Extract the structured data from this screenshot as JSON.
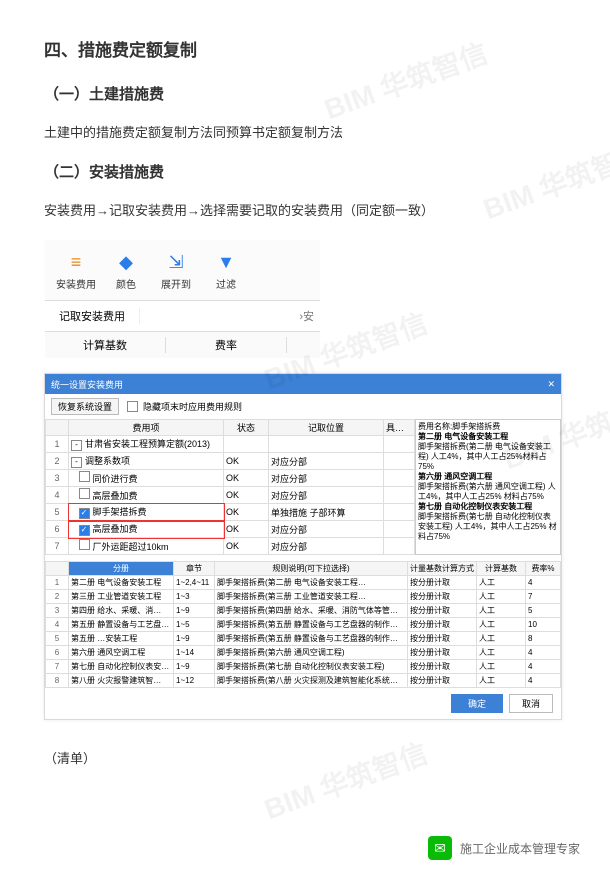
{
  "doc": {
    "h1": "四、措施费定额复制",
    "h2a": "（一）土建措施费",
    "p1": "土建中的措施费定额复制方法同预算书定额复制方法",
    "h2b": "（二）安装措施费",
    "p2": "安装费用→记取安装费用→选择需要记取的安装费用（同定额一致）",
    "note": "（清单）"
  },
  "toolbar": {
    "items": [
      {
        "icon": "≡",
        "label": "安装费用",
        "cls": "tb-orange"
      },
      {
        "icon": "◆",
        "label": "颜色",
        "cls": "tb-blue"
      },
      {
        "icon": "⇲",
        "label": "展开到",
        "cls": "tb-blue"
      },
      {
        "icon": "▼",
        "label": "过滤",
        "cls": "tb-blue"
      }
    ],
    "menu": "记取安装费用",
    "after_menu": "›安",
    "tab_a": "计算基数",
    "tab_b": "费率"
  },
  "dlg": {
    "title": "统一设置安装费用",
    "restore": "恢复系统设置",
    "chk_show": "隐藏项末时应用费用规则",
    "top_headers": [
      "",
      "费用项",
      "状态",
      "记取位置",
      "具体说明"
    ],
    "tree": [
      {
        "n": "1",
        "txt": "甘肃省安装工程预算定额(2013)",
        "open": "-",
        "st": "",
        "pos": "",
        "chk": null
      },
      {
        "n": "2",
        "txt": "调整系数项",
        "open": "-",
        "st": "OK",
        "pos": "对应分部",
        "chk": null
      },
      {
        "n": "3",
        "txt": "同价进行费",
        "st": "OK",
        "pos": "对应分部",
        "chk": false
      },
      {
        "n": "4",
        "txt": "高层叠加费",
        "st": "OK",
        "pos": "对应分部",
        "chk": false
      },
      {
        "n": "5",
        "txt": "脚手架搭拆费",
        "st": "OK",
        "pos": "单独措施  子部环算",
        "chk": true,
        "hl": true
      },
      {
        "n": "6",
        "txt": "高层叠加费",
        "st": "OK",
        "pos": "对应分部",
        "chk": true,
        "hl": true
      },
      {
        "n": "7",
        "txt": "厂外运距超过10km",
        "st": "OK",
        "pos": "对应分部",
        "chk": false
      }
    ],
    "side": {
      "t": "费用名称:脚手架搭拆费",
      "b1": "第二册 电气设备安装工程",
      "b1t": "脚手架搭拆费(第二册 电气设备安装工程) 人工4%，其中人工占25%材料占75%",
      "b2": "第六册 通风空调工程",
      "b2t": "脚手架搭拆费(第六册 通风空调工程) 人工4%，其中人工占25% 材料占75%",
      "b3": "第七册 自动化控制仪表安装工程",
      "b3t": "脚手架搭拆费(第七册 自动化控制仪表安装工程) 人工4%，其中人工占25% 材料占75%"
    },
    "bot_headers": [
      "",
      "分册",
      "章节",
      "规则说明(可下拉选择)",
      "计量基数计算方式",
      "计算基数",
      "费率%"
    ],
    "rows": [
      {
        "n": "1",
        "a": "第二册 电气设备安装工程",
        "b": "1~2,4~11",
        "c": "脚手架搭拆费(第二册 电气设备安装工程…",
        "d": "按分册计取",
        "e": "人工",
        "f": "4"
      },
      {
        "n": "2",
        "a": "第三册 工业管道安装工程",
        "b": "1~3",
        "c": "脚手架搭拆费(第三册 工业管道安装工程…",
        "d": "按分册计取",
        "e": "人工",
        "f": "7"
      },
      {
        "n": "3",
        "a": "第四册 给水、采暖、消…",
        "b": "1~9",
        "c": "脚手架搭拆费(第四册 给水、采暖、消防气体等管道安装工…",
        "d": "按分册计取",
        "e": "人工",
        "f": "5"
      },
      {
        "n": "4",
        "a": "第五册 静置设备与工艺盘…",
        "b": "1~5",
        "c": "脚手架搭拆费(第五册 静置设备与工艺盘器的制作安装工程…",
        "d": "按分册计取",
        "e": "人工",
        "f": "10"
      },
      {
        "n": "5",
        "a": "第五册 …安装工程",
        "b": "1~9",
        "c": "脚手架搭拆费(第五册 静置设备与工艺盘器的制作…",
        "d": "按分册计取",
        "e": "人工",
        "f": "8"
      },
      {
        "n": "6",
        "a": "第六册 通风空调工程",
        "b": "1~14",
        "c": "脚手架搭拆费(第六册 通风空调工程)",
        "d": "按分册计取",
        "e": "人工",
        "f": "4"
      },
      {
        "n": "7",
        "a": "第七册 自动化控制仪表安装…",
        "b": "1~9",
        "c": "脚手架搭拆费(第七册 自动化控制仪表安装工程)",
        "d": "按分册计取",
        "e": "人工",
        "f": "4"
      },
      {
        "n": "8",
        "a": "第八册 火灾报警建筑智…",
        "b": "1~12",
        "c": "脚手架搭拆费(第八册 火灾探测及建筑智能化系统设备安装…",
        "d": "按分册计取",
        "e": "人工",
        "f": "4"
      }
    ],
    "ok": "确定",
    "cancel": "取消"
  },
  "footer": {
    "acct": "施工企业成本管理专家"
  },
  "wm": "BIM 华筑智信"
}
